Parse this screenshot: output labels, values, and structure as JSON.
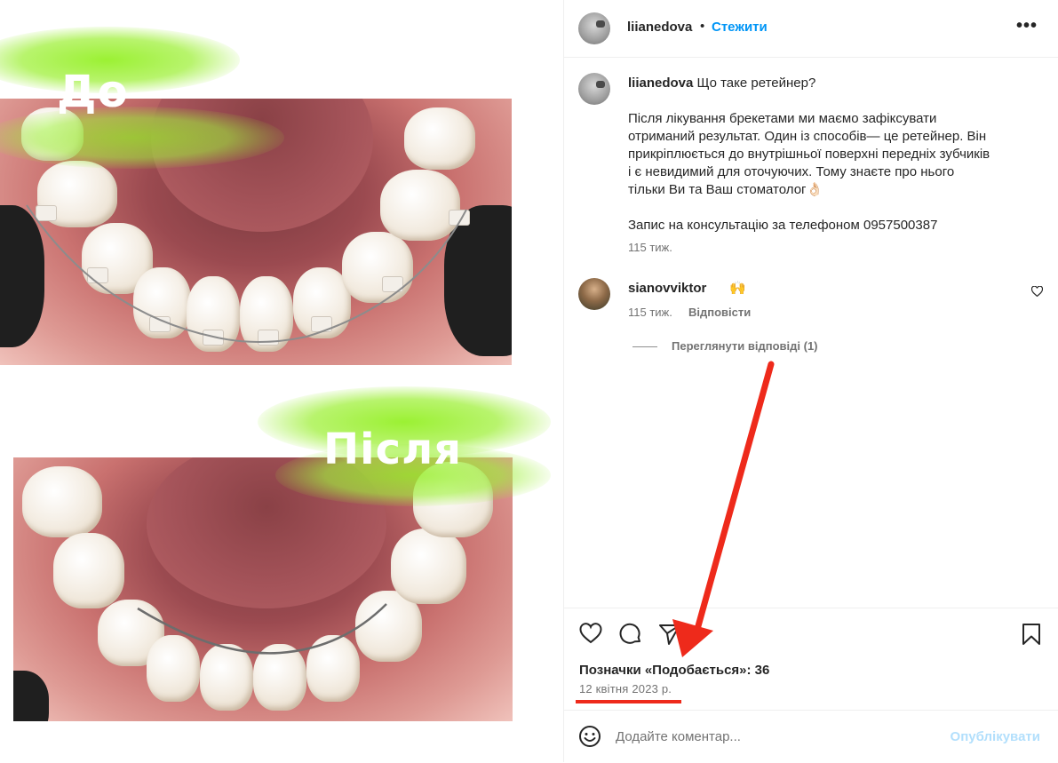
{
  "media": {
    "before_label": "До",
    "after_label": "Після"
  },
  "header": {
    "username": "liianedova",
    "separator": "•",
    "follow_label": "Стежити",
    "more_icon": "more-horizontal-icon"
  },
  "caption": {
    "username": "liianedova",
    "title": "Що таке ретейнер?",
    "paragraphs": [
      "Після лікування брекетами ми маємо зафіксувати\nотриманий результат. Один із способів— це ретейнер. Він\nприкріплюється до внутрішньої поверхні передніх зубчиків\nі є невидимий для оточуючих. Тому знаєте про нього\nтільки Ви та Ваш стоматолог👌🏻",
      "Запис на консультацію за телефоном 0957500387"
    ],
    "time": "115 тиж."
  },
  "comment": {
    "username": "sianovviktor",
    "emoji": "🙌",
    "time": "115 тиж.",
    "reply_label": "Відповісти",
    "view_replies_label": "Переглянути відповіді (1)"
  },
  "post": {
    "likes_text": "Позначки «Подобається»: 36",
    "date": "12 квітня 2023 р."
  },
  "comment_bar": {
    "placeholder": "Додайте коментар...",
    "publish_label": "Опублікувати"
  },
  "colors": {
    "accent_blue": "#0095f6",
    "annotation_red": "#ee2a1b",
    "highlight_green": "#9ef03c"
  }
}
